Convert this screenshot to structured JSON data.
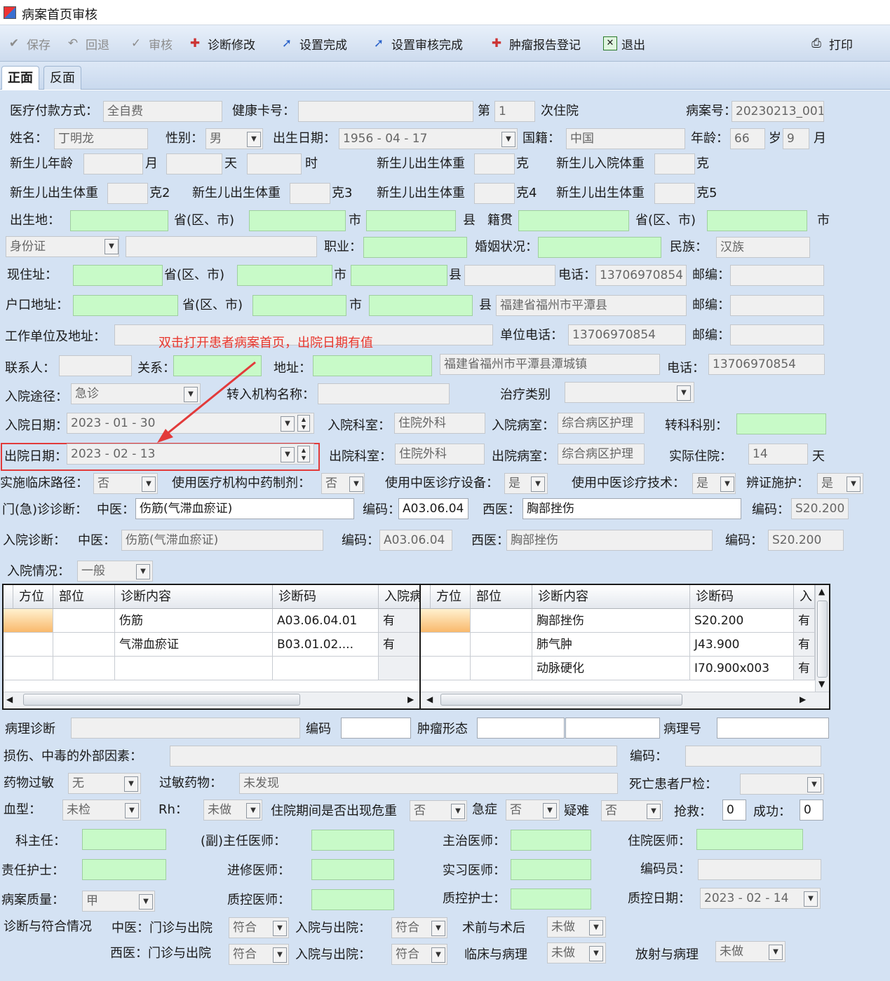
{
  "window": {
    "title": "病案首页审核"
  },
  "toolbar": {
    "save": "保存",
    "rollback": "回退",
    "audit": "审核",
    "diag_modify": "诊断修改",
    "set_complete": "设置完成",
    "set_audit_complete": "设置审核完成",
    "tumor_report": "肿瘤报告登记",
    "exit": "退出",
    "print": "打印"
  },
  "tabs": {
    "front": "正面",
    "back": "反面"
  },
  "annotation": {
    "text": "双击打开患者病案首页，出院日期有值"
  },
  "labels": {
    "pay_method": "医疗付款方式：",
    "health_card": "健康卡号：",
    "nth": "第",
    "times": "次住院",
    "case_no": "病案号：",
    "name": "姓名：",
    "gender": "性别：",
    "birth": "出生日期：",
    "nationality": "国籍：",
    "age": "年龄：",
    "years": "岁",
    "months": "月",
    "nb_age": "新生儿年龄",
    "month_u": "月",
    "day_u": "天",
    "hour_u": "时",
    "nb_birth_wt": "新生儿出生体重",
    "gram": "克",
    "nb_adm_wt": "新生儿入院体重",
    "gram2": "克2",
    "gram3": "克3",
    "gram4": "克4",
    "gram5": "克5",
    "birthplace": "出生地：",
    "province": "省(区、市)",
    "city": "市",
    "county": "县",
    "native": "籍贯",
    "occupation": "职业：",
    "marital": "婚姻状况：",
    "ethnic": "民族：",
    "cur_addr": "现住址：",
    "phone": "电话：",
    "postcode": "邮编：",
    "hukou": "户口地址：",
    "work": "工作单位及地址：",
    "work_phone": "单位电话：",
    "contact": "联系人：",
    "relation": "关系：",
    "address": "地址：",
    "adm_route": "入院途径：",
    "transfer_org": "转入机构名称：",
    "treat_type": "治疗类别",
    "adm_date": "入院日期：",
    "adm_dept": "入院科室：",
    "adm_ward": "入院病室：",
    "transfer_dept": "转科科别：",
    "dis_date": "出院日期：",
    "dis_dept": "出院科室：",
    "dis_ward": "出院病室：",
    "actual_days": "实际住院：",
    "day": "天",
    "clin_path": "实施临床路径：",
    "tcm_prep": "使用医疗机构中药制剂：",
    "tcm_equip": "使用中医诊疗设备：",
    "tcm_tech": "使用中医诊疗技术：",
    "syndrome_care": "辨证施护：",
    "er_diag": "门(急)诊诊断：",
    "tcm": "中医：",
    "code": "编码：",
    "wm": "西医：",
    "adm_diag": "入院诊断：",
    "tcm2": "中医：",
    "adm_cond": "入院情况：",
    "path_diag": "病理诊断",
    "code_plain": "编码",
    "tumor_form": "肿瘤形态",
    "path_no": "病理号",
    "injury": "损伤、中毒的外部因素：",
    "code2": "编码：",
    "drug_allergy": "药物过敏",
    "allergy_drug": "过敏药物：",
    "autopsy": "死亡患者尸检：",
    "blood": "血型：",
    "rh": "Rh：",
    "critical": "住院期间是否出现危重",
    "emergency": "急症",
    "difficult": "疑难",
    "rescue": "抢救：",
    "success": "成功：",
    "dept_head": "科主任：",
    "chief_doc": "(副)主任医师：",
    "attending": "主治医师：",
    "resident": "住院医师：",
    "nurse": "责任护士：",
    "advanced_doc": "进修医师：",
    "intern": "实习医师：",
    "coder": "编码员：",
    "quality": "病案质量：",
    "qc_doc": "质控医师：",
    "qc_nurse": "质控护士：",
    "qc_date": "质控日期：",
    "conform": "诊断与符合情况",
    "tcm_er_dis": "中医：门诊与出院",
    "adm_dis": "入院与出院：",
    "preop": "术前与术后",
    "wm_er_dis": "西医：门诊与出院",
    "adm_dis2": "入院与出院：",
    "clin_path_cmp": "临床与病理",
    "rad_path": "放射与病理"
  },
  "values": {
    "pay_method": "全自费",
    "nth": "1",
    "case_no": "20230213_001",
    "name": "丁明龙",
    "gender": "男",
    "birth": "1956 - 04 - 17",
    "nationality": "中国",
    "age": "66",
    "age_m": "9",
    "id_type": "身份证",
    "ethnic": "汉族",
    "phone": "13706970854",
    "hukou_full": "福建省福州市平潭县",
    "work_phone": "13706970854",
    "contact_addr": "福建省福州市平潭县潭城镇",
    "contact_phone": "13706970854",
    "adm_route": "急诊",
    "adm_date": "2023 - 01 - 30",
    "adm_dept": "住院外科",
    "adm_ward": "综合病区护理",
    "dis_date": "2023 - 02 - 13",
    "dis_dept": "住院外科",
    "dis_ward": "综合病区护理",
    "actual_days": "14",
    "clin_path": "否",
    "tcm_prep": "否",
    "tcm_equip": "是",
    "tcm_tech": "是",
    "syndrome_care": "是",
    "er_tcm": "伤筋(气滞血瘀证)",
    "er_tcm_code": "A03.06.04",
    "er_wm": "胸部挫伤",
    "er_wm_code": "S20.200",
    "adm_tcm": "伤筋(气滞血瘀证)",
    "adm_tcm_code": "A03.06.04",
    "adm_wm": "胸部挫伤",
    "adm_wm_code": "S20.200",
    "adm_cond": "一般",
    "drug_allergy": "无",
    "allergy_drug": "未发现",
    "blood": "未检",
    "rh": "未做",
    "critical": "否",
    "emergency": "否",
    "difficult": "否",
    "rescue": "0",
    "success": "0",
    "quality": "甲",
    "qc_date": "2023 - 02 - 14",
    "c1": "符合",
    "c2": "符合",
    "c3": "未做",
    "c4": "符合",
    "c5": "符合",
    "c6": "未做",
    "c7": "未做"
  },
  "grid_left": {
    "headers": [
      "方位",
      "部位",
      "诊断内容",
      "诊断码",
      "入院病"
    ],
    "rows": [
      [
        "",
        "",
        "伤筋",
        "A03.06.04.01",
        "有"
      ],
      [
        "",
        "",
        "气滞血瘀证",
        "B03.01.02....",
        "有"
      ],
      [
        "",
        "",
        "",
        "",
        ""
      ]
    ]
  },
  "grid_right": {
    "headers": [
      "方位",
      "部位",
      "诊断内容",
      "诊断码",
      "入"
    ],
    "rows": [
      [
        "",
        "",
        "胸部挫伤",
        "S20.200",
        "有"
      ],
      [
        "",
        "",
        "肺气肿",
        "J43.900",
        "有"
      ],
      [
        "",
        "",
        "动脉硬化",
        "I70.900x003",
        "有"
      ]
    ]
  }
}
